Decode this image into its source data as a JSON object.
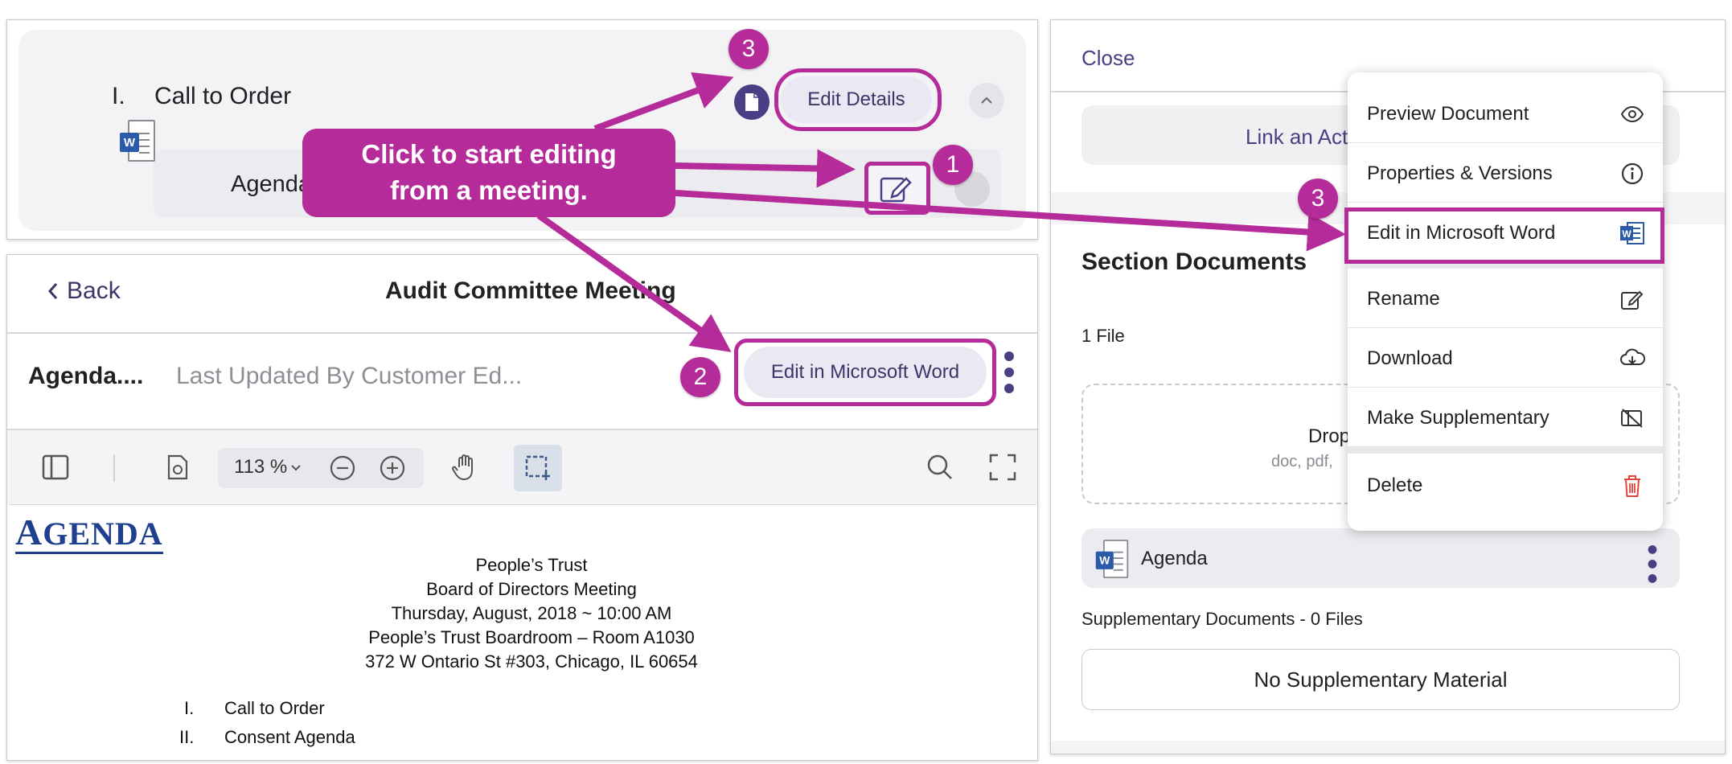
{
  "agenda_item": {
    "number": "I.",
    "title": "Call to Order",
    "doc_name": "Agenda",
    "edit_details_label": "Edit Details"
  },
  "viewer": {
    "back_label": "Back",
    "meeting_title": "Audit Committee Meeting",
    "doc_title": "Agenda....",
    "last_updated": "Last Updated By Customer Ed...",
    "edit_word_label": "Edit in Microsoft Word",
    "zoom": "113 %"
  },
  "document": {
    "heading_first": "A",
    "heading_rest": "GENDA",
    "lines": [
      "People’s Trust",
      "Board of Directors Meeting",
      "Thursday, August, 2018 ~ 10:00 AM",
      "People’s Trust Boardroom – Room A1030",
      "372 W Ontario St #303, Chicago, IL 60654"
    ],
    "items": [
      {
        "num": "I.",
        "text": "Call to Order"
      },
      {
        "num": "II.",
        "text": "Consent Agenda"
      }
    ]
  },
  "section_panel": {
    "close_label": "Close",
    "link_action_label": "Link an Acti",
    "section_title": "Section Documents",
    "file_count": "1 File",
    "drop_title": "Drop",
    "drop_sub": "doc, pdf, ",
    "doc_name": "Agenda",
    "supp_title": "Supplementary Documents - 0 Files",
    "no_supp_label": "No Supplementary Material"
  },
  "context_menu": {
    "items": [
      {
        "label": "Preview Document",
        "icon": "eye-icon"
      },
      {
        "label": "Properties & Versions",
        "icon": "info-icon"
      },
      {
        "label": "Edit in Microsoft Word",
        "icon": "word-icon"
      },
      {
        "label": "Rename",
        "icon": "edit-icon"
      },
      {
        "label": "Download",
        "icon": "cloud-download-icon"
      },
      {
        "label": "Make Supplementary",
        "icon": "supplementary-icon"
      },
      {
        "label": "Delete",
        "icon": "trash-icon"
      }
    ]
  },
  "annotations": {
    "callout_line1": "Click to start editing",
    "callout_line2": "from a meeting.",
    "badge_1": "1",
    "badge_2": "2",
    "badge_3": "3"
  },
  "colors": {
    "accent_magenta": "#b52b9a",
    "brand_purple": "#4a3f84",
    "word_blue": "#2b5aa8",
    "delete_red": "#e0453a"
  }
}
